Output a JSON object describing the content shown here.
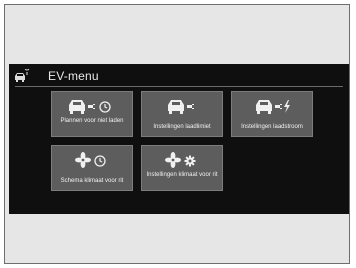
{
  "header": {
    "title": "EV-menu",
    "icon": "car-plug-icon"
  },
  "tiles": [
    {
      "label": "Plannen voor niet laden",
      "icon": "car-plug-clock-icon"
    },
    {
      "label": "Instellingen laadlimiet",
      "icon": "car-plug-icon"
    },
    {
      "label": "Instellingen laadstroom",
      "icon": "car-lightning-icon"
    },
    {
      "label": "Schema klimaat voor rit",
      "icon": "fan-clock-icon"
    },
    {
      "label": "Instellingen klimaat voor rit",
      "icon": "fan-gear-icon"
    }
  ],
  "colors": {
    "screen_bg": "#0f0f0f",
    "tile_bg": "#5d5d5d",
    "text": "#f2f2f2"
  }
}
